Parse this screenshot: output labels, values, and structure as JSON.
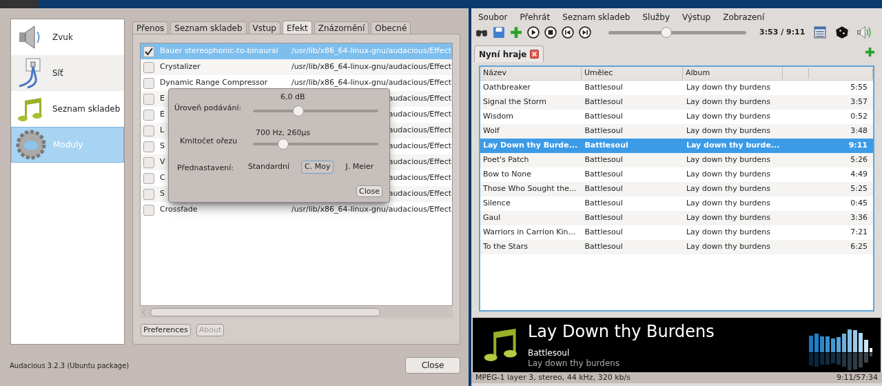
{
  "prefs": {
    "sidebar": [
      {
        "label": "Zvuk",
        "selected": false
      },
      {
        "label": "Síť",
        "selected": false
      },
      {
        "label": "Seznam skladeb",
        "selected": false
      },
      {
        "label": "Moduly",
        "selected": true
      }
    ],
    "tabs": [
      {
        "label": "Přenos",
        "selected": false
      },
      {
        "label": "Seznam skladeb",
        "selected": false
      },
      {
        "label": "Vstup",
        "selected": false
      },
      {
        "label": "Efekt",
        "selected": true
      },
      {
        "label": "Znázornění",
        "selected": false
      },
      {
        "label": "Obecné",
        "selected": false
      }
    ],
    "plugins": [
      {
        "name": "Bauer stereophonic-to-binaural",
        "path": "/usr/lib/x86_64-linux-gnu/audacious/Effect",
        "checked": true,
        "selected": true
      },
      {
        "name": "Crystalizer",
        "path": "/usr/lib/x86_64-linux-gnu/audacious/Effect",
        "checked": false,
        "selected": false
      },
      {
        "name": "Dynamic Range Compressor",
        "path": "/usr/lib/x86_64-linux-gnu/audacious/Effect",
        "checked": false,
        "selected": false
      },
      {
        "name": "E",
        "path": "audacious/Effect",
        "checked": false,
        "selected": false
      },
      {
        "name": "E",
        "path": "audacious/Effect",
        "checked": false,
        "selected": false
      },
      {
        "name": "L",
        "path": "audacious/Effect",
        "checked": false,
        "selected": false
      },
      {
        "name": "S",
        "path": "audacious/Effect",
        "checked": false,
        "selected": false
      },
      {
        "name": "V",
        "path": "audacious/Effect",
        "checked": false,
        "selected": false
      },
      {
        "name": "C",
        "path": "audacious/Effect",
        "checked": false,
        "selected": false
      },
      {
        "name": "S",
        "path": "audacious/Effect",
        "checked": false,
        "selected": false
      },
      {
        "name": "Crossfade",
        "path": "/usr/lib/x86_64-linux-gnu/audacious/Effect",
        "checked": false,
        "selected": false
      }
    ],
    "buttons": [
      {
        "label": "Preferences",
        "disabled": false
      },
      {
        "label": "About",
        "disabled": true
      }
    ],
    "footer": "Audacious 3.2.3 (Ubuntu package)",
    "close": "Close"
  },
  "bs2b": {
    "sliders": [
      {
        "label": "Úroveň podávání:",
        "reading": "6,0 dB",
        "level": 0.36
      },
      {
        "label": "Kmitočet ořezu",
        "reading": "700 Hz, 260µs",
        "level": 0.24
      }
    ],
    "presets_label": "Přednastavení:",
    "presets": [
      {
        "label": "Standardní",
        "selected": false
      },
      {
        "label": "C. Moy",
        "selected": true
      },
      {
        "label": "J. Meier",
        "selected": false
      }
    ],
    "close": "Close"
  },
  "player": {
    "menu": [
      "Soubor",
      "Přehrát",
      "Seznam skladeb",
      "Služby",
      "Výstup",
      "Zobrazení"
    ],
    "seek": {
      "level": 0.42
    },
    "time": "3:53 / 9:11",
    "playlist_tab": "Nyní hraje",
    "columns": [
      "Název",
      "Umělec",
      "Album"
    ],
    "rows": [
      {
        "title": "Oathbreaker",
        "artist": "Battlesoul",
        "album": "Lay down thy burdens",
        "length": "5:55",
        "selected": false
      },
      {
        "title": "Signal the Storm",
        "artist": "Battlesoul",
        "album": "Lay down thy burdens",
        "length": "3:57",
        "selected": false
      },
      {
        "title": "Wisdom",
        "artist": "Battlesoul",
        "album": "Lay down thy burdens",
        "length": "0:52",
        "selected": false
      },
      {
        "title": "Wolf",
        "artist": "Battlesoul",
        "album": "Lay down thy burdens",
        "length": "3:48",
        "selected": false
      },
      {
        "title": "Lay Down thy Burde...",
        "artist": "Battlesoul",
        "album": "Lay down thy burde...",
        "length": "9:11",
        "selected": true
      },
      {
        "title": "Poet's Patch",
        "artist": "Battlesoul",
        "album": "Lay down thy burdens",
        "length": "5:26",
        "selected": false
      },
      {
        "title": "Bow to None",
        "artist": "Battlesoul",
        "album": "Lay down thy burdens",
        "length": "4:49",
        "selected": false
      },
      {
        "title": "Those Who Sought the...",
        "artist": "Battlesoul",
        "album": "Lay down thy burdens",
        "length": "5:25",
        "selected": false
      },
      {
        "title": "Silence",
        "artist": "Battlesoul",
        "album": "Lay down thy burdens",
        "length": "0:45",
        "selected": false
      },
      {
        "title": "Gaul",
        "artist": "Battlesoul",
        "album": "Lay down thy burdens",
        "length": "3:36",
        "selected": false
      },
      {
        "title": "Warriors in Carrion Kin...",
        "artist": "Battlesoul",
        "album": "Lay down thy burdens",
        "length": "7:21",
        "selected": false
      },
      {
        "title": "To the Stars",
        "artist": "Battlesoul",
        "album": "Lay down thy burdens",
        "length": "6:25",
        "selected": false
      }
    ],
    "now_playing": {
      "title": "Lay Down thy Burdens",
      "artist": "Battlesoul",
      "album": "Lay down thy burdens"
    },
    "status_left": "MPEG-1 layer 3, stereo, 44 kHz, 320 kb/s",
    "status_right": "9:11/57:34"
  }
}
